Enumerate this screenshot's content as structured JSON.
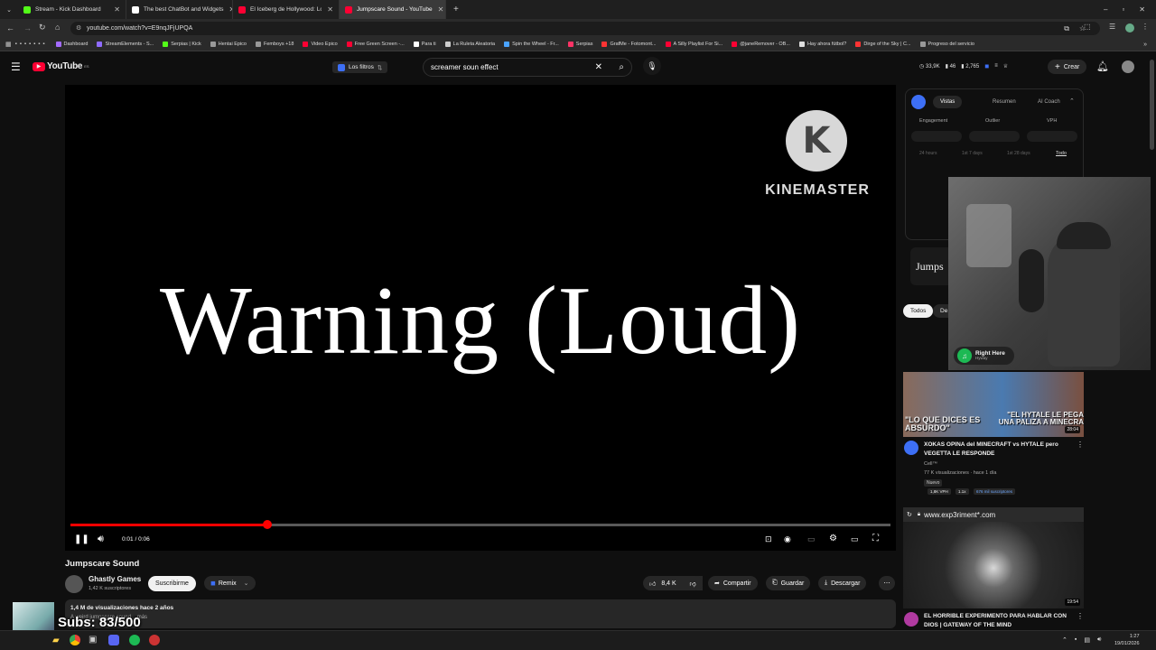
{
  "browser": {
    "tabs": [
      {
        "label": "Stream - Kick Dashboard",
        "color": "#53fc18"
      },
      {
        "label": "The best ChatBot and Widgets",
        "color": "#ffffff"
      },
      {
        "label": "El Iceberg de Hollywood: Los M",
        "color": "#ff0033"
      },
      {
        "label": "Jumpscare Sound - YouTube",
        "color": "#ff0033"
      }
    ],
    "url": "youtube.com/watch?v=E9nqJFjUPQA",
    "bookmarks": [
      {
        "label": "Dashboard",
        "color": "#a36bff"
      },
      {
        "label": "StreamElements - S...",
        "color": "#8f6bff"
      },
      {
        "label": "Serpias | Kick",
        "color": "#53fc18"
      },
      {
        "label": "Hentai Epico",
        "color": "#999999"
      },
      {
        "label": "Femboys +18",
        "color": "#999999"
      },
      {
        "label": "Video Epico",
        "color": "#ff0033"
      },
      {
        "label": "Free Green Screen -...",
        "color": "#ff0033"
      },
      {
        "label": "Para ti",
        "color": "#ffffff"
      },
      {
        "label": "La Ruleta Aleatoria",
        "color": "#cccccc"
      },
      {
        "label": "Spin the Wheel - Fr...",
        "color": "#4aa3ff"
      },
      {
        "label": "Serpias",
        "color": "#ff3366"
      },
      {
        "label": "GrafMe - Fotomont...",
        "color": "#ff3333"
      },
      {
        "label": "A Silly Playlist For Si...",
        "color": "#ff0033"
      },
      {
        "label": "@janeRemover - OB...",
        "color": "#ff0033"
      },
      {
        "label": "Hay ahora fútbol?",
        "color": "#dddddd"
      },
      {
        "label": "Dirge of the Sky | C...",
        "color": "#ff3333"
      },
      {
        "label": "Progreso del servicio",
        "color": "#999999"
      }
    ]
  },
  "youtube": {
    "logo_text": "YouTube",
    "logo_region": "ES",
    "filters_label": "Los filtros",
    "search_value": "screamer soun effect",
    "stats": {
      "views": "33,9K",
      "likes": "46",
      "subs": "2,765"
    },
    "create_label": "Crear"
  },
  "video": {
    "watermark": "KINEMASTER",
    "overlay_text": "Warning (Loud)",
    "time": "0:01 / 0:06",
    "progress_fraction": 0.24,
    "title": "Jumpscare Sound",
    "channel": "Ghastly Games",
    "subscribers": "1,42 K suscriptores",
    "subscribe_label": "Suscribirme",
    "remix_label": "Remix",
    "likes": "8,4 K",
    "share_label": "Compartir",
    "save_label": "Guardar",
    "download_label": "Descargar",
    "views_line": "1,4 M de visualizaciones  hace 2 años",
    "description": "A weird jumpscare sound ...más"
  },
  "extension": {
    "tabs": [
      "Vistas",
      "Resumen",
      "AI Coach"
    ],
    "metrics": [
      "Engagement",
      "Outlier",
      "VPH"
    ],
    "ranges": [
      "24 hours",
      "1st 7 days",
      "1st 28 days",
      "Todo"
    ]
  },
  "sidebar": {
    "partial_title": "Jumps",
    "chips": [
      "Todos",
      "De"
    ],
    "music_title": "Right Here",
    "music_artist": "Hyway",
    "video1": {
      "thumb_left": "\"LO QUE DICES ES ABSURDO\"",
      "thumb_right": "\"EL HYTALE LE PEGA UNA PALIZA A MINECRA",
      "duration": "28:04",
      "title": "XOKAS OPINA del MINECRAFT vs HYTALE pero VEGETTA LE RESPONDE",
      "channel": "Cell™",
      "meta": "77 K visualizaciones · hace 1 día",
      "badge": "Nuevo",
      "vph": "1,8K VPH",
      "mult": "1.1x",
      "subs": "676 mil suscriptores"
    },
    "video2": {
      "thumb_url": "www.exp3riment*.com",
      "duration": "19:54",
      "title": "EL HORRIBLE EXPERIMENTO PARA HABLAR CON DIOS | GATEWAY OF THE MIND"
    }
  },
  "stream_overlay": {
    "subs": "Subs: 83/500"
  },
  "taskbar": {
    "time": "1:27",
    "date": "19/01/2026"
  }
}
